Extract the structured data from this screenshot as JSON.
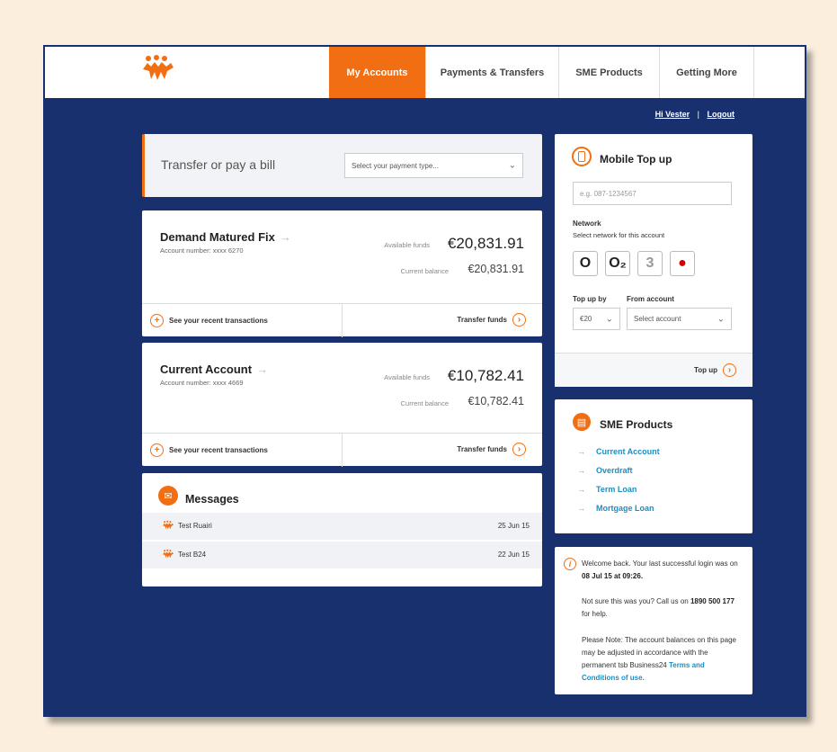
{
  "nav": {
    "tabs": [
      {
        "label": "My Accounts",
        "active": true
      },
      {
        "label": "Payments & Transfers"
      },
      {
        "label": "SME Products"
      },
      {
        "label": "Getting More"
      }
    ]
  },
  "user": {
    "greeting": "Hi Vester",
    "logout": "Logout"
  },
  "transfer": {
    "label": "Transfer or pay a bill",
    "select_placeholder": "Select your payment type..."
  },
  "accounts": [
    {
      "name": "Demand Matured Fix",
      "number": "Account number: xxxx 6270",
      "available_label": "Available funds",
      "available": "€20,831.91",
      "current_label": "Current balance",
      "current": "€20,831.91",
      "recent": "See your recent transactions",
      "transfer": "Transfer funds"
    },
    {
      "name": "Current Account",
      "number": "Account number: xxxx 4669",
      "available_label": "Available funds",
      "available": "€10,782.41",
      "current_label": "Current balance",
      "current": "€10,782.41",
      "recent": "See your recent transactions",
      "transfer": "Transfer funds"
    }
  ],
  "messages": {
    "title": "Messages",
    "items": [
      {
        "from": "Test Ruairi",
        "date": "25 Jun 15"
      },
      {
        "from": "Test B24",
        "date": "22 Jun 15"
      }
    ]
  },
  "topup": {
    "title": "Mobile Top up",
    "phone_placeholder": "e.g. 087-1234567",
    "network_label": "Network",
    "network_hint": "Select network for this account",
    "operators": [
      "O",
      "O₂",
      "3",
      "●"
    ],
    "topup_by_label": "Top up by",
    "topup_by_value": "€20",
    "from_label": "From account",
    "from_value": "Select account",
    "button": "Top up"
  },
  "sme": {
    "title": "SME Products",
    "items": [
      "Current Account",
      "Overdraft",
      "Term Loan",
      "Mortgage Loan"
    ]
  },
  "info": {
    "line1_prefix": "Welcome back. Your last successful login was on ",
    "line1_date": "08 Jul 15 at 09:26.",
    "line2_prefix": "Not sure this was you? Call us on ",
    "line2_phone": "1890 500 177",
    "line2_suffix": " for help.",
    "line3_prefix": "Please Note: The account balances on this page may be adjusted in accordance with the permanent tsb Business24 ",
    "line3_link": "Terms and Conditions of use."
  },
  "colors": {
    "brand_orange": "#f26e12",
    "navy": "#18306e",
    "link_blue": "#1a8ec4"
  }
}
